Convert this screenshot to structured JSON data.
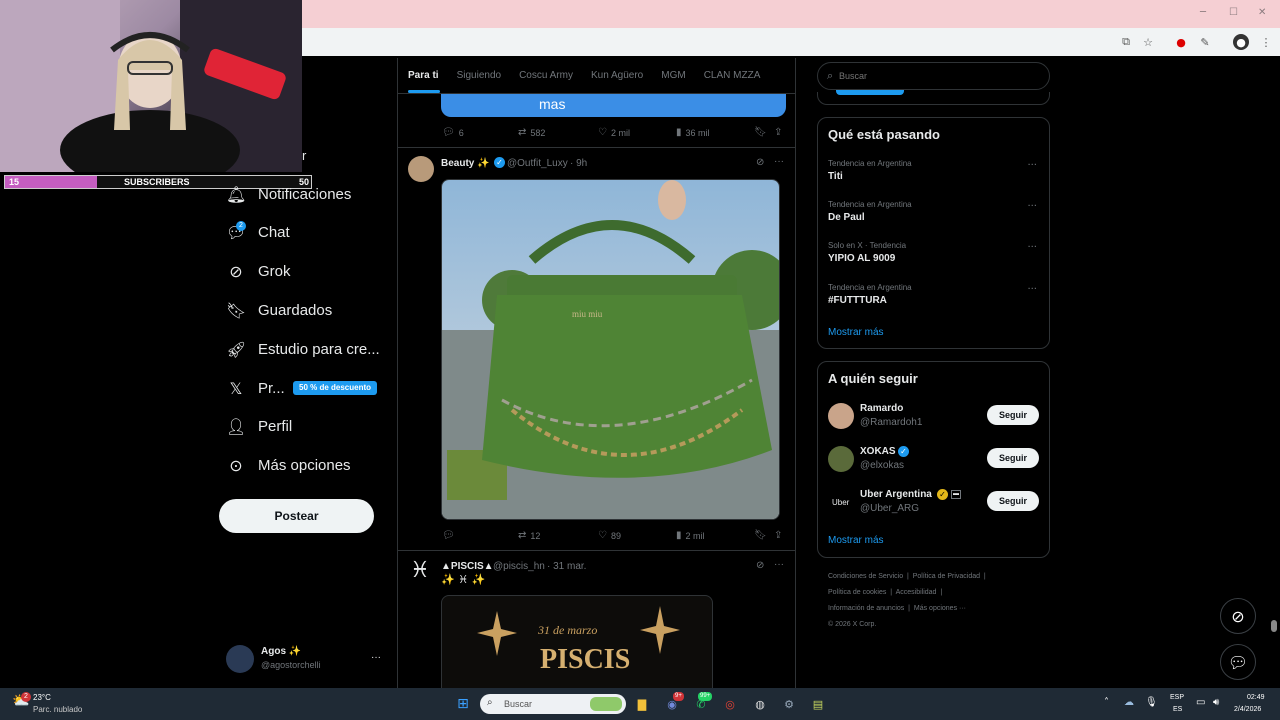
{
  "browser": {
    "min_icon": "minimize-icon",
    "max_icon": "maximize-icon",
    "close_icon": "close-icon"
  },
  "stream_overlay": {
    "subs_current": "15",
    "subs_label": "SUBSCRIBERS",
    "subs_goal": "50",
    "subs_progress": 0.3
  },
  "sidebar": {
    "partial_label": "r",
    "items": [
      {
        "label": "Notificaciones",
        "icon": "bell-icon"
      },
      {
        "label": "Chat",
        "icon": "chat-icon",
        "badge": "2"
      },
      {
        "label": "Grok",
        "icon": "grok-icon"
      },
      {
        "label": "Guardados",
        "icon": "bookmark-icon"
      },
      {
        "label": "Estudio para cre...",
        "icon": "rocket-icon"
      },
      {
        "label": "Pr...",
        "icon": "x-logo-icon",
        "promo": "50 % de descuento"
      },
      {
        "label": "Perfil",
        "icon": "person-icon"
      },
      {
        "label": "Más opciones",
        "icon": "more-circle-icon"
      }
    ],
    "post_button": "Postear",
    "account": {
      "name": "Agos ✨",
      "handle": "@agostorchelli",
      "more": "···"
    }
  },
  "feed": {
    "tabs": [
      "Para ti",
      "Siguiendo",
      "Coscu Army",
      "Kun Agüero",
      "MGM",
      "CLAN MZZA"
    ],
    "active_tab": 0,
    "post0": {
      "bubble_text": "mas",
      "replies": "6",
      "reposts": "582",
      "likes": "2 mil",
      "views": "36 mil"
    },
    "post1": {
      "name": "Beauty ✨",
      "handle": "@Outfit_Luxy",
      "time": "· 9h",
      "image_text": "miu miu",
      "replies": "",
      "reposts": "12",
      "likes": "89",
      "views": "2 mil"
    },
    "post2": {
      "name": "▲PISCIS▲",
      "handle": "@piscis_hn",
      "time": "· 31 mar.",
      "text": "✨ ♓ ✨",
      "image_line1": "31 de marzo",
      "image_line2": "PISCIS"
    }
  },
  "right": {
    "search_placeholder": "Buscar",
    "trending_title": "Qué está pasando",
    "trends": [
      {
        "meta": "Tendencia en Argentina",
        "name": "Titi"
      },
      {
        "meta": "Tendencia en Argentina",
        "name": "De Paul"
      },
      {
        "meta": "Solo en X · Tendencia",
        "name": "YIPIO AL 9009"
      },
      {
        "meta": "Tendencia en Argentina",
        "name": "#FUTTTURA"
      }
    ],
    "show_more": "Mostrar más",
    "follow_title": "A quién seguir",
    "follow": [
      {
        "name": "Ramardo",
        "handle": "@Ramardoh1",
        "button": "Seguir"
      },
      {
        "name": "XOKAS",
        "handle": "@elxokas",
        "button": "Seguir"
      },
      {
        "name": "Uber Argentina",
        "handle": "@Uber_ARG",
        "button": "Seguir",
        "avatar_text": "Uber"
      }
    ],
    "follow_more": "Mostrar más",
    "footer": {
      "l1a": "Condiciones de Servicio",
      "l1b": "Política de Privacidad",
      "l2a": "Política de cookies",
      "l2b": "Accesibilidad",
      "l3a": "Información de anuncios",
      "l3b": "Más opciones ···",
      "copyright": "© 2026 X Corp."
    }
  },
  "taskbar": {
    "weather_temp": "23°C",
    "weather_desc": "Parc. nublado",
    "weather_badge": "2",
    "search_placeholder": "Buscar",
    "discord_badge": "9+",
    "whatsapp_badge": "99+",
    "lang1": "ESP",
    "lang2": "ES",
    "time": "02:49",
    "date": "2/4/2026"
  },
  "colors": {
    "accent": "#1d9bf0",
    "promo": "#1d9bf0",
    "background": "#000000",
    "titlebar": "#f5cfd3"
  }
}
